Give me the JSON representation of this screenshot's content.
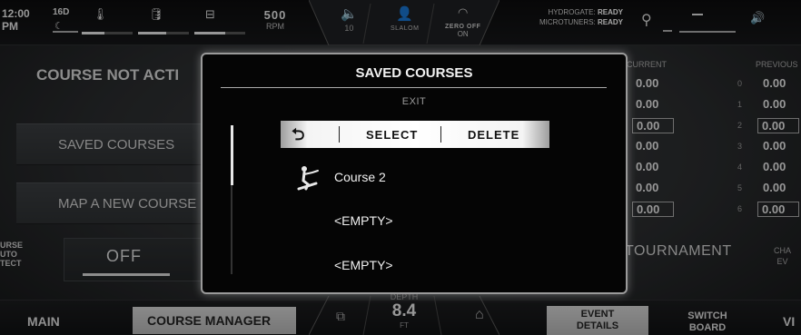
{
  "topbar": {
    "time_line1": "12:00",
    "time_line2": "PM",
    "temp": "16D",
    "rpm_value": "500",
    "rpm_unit": "RPM",
    "volume_level": "10",
    "slalom_label": "SLALOM",
    "zerooff_label": "ZERO OFF",
    "zerooff_state": "ON",
    "hydrogate_label": "HYDROGATE:",
    "hydrogate_status": "READY",
    "microtuners_label": "MICROTUNERS:",
    "microtuners_status": "READY",
    "gauges": [
      {
        "icon": "thermometer-icon",
        "level": 0.45
      },
      {
        "icon": "oil-can-icon",
        "level": 0.55
      },
      {
        "icon": "battery-icon",
        "level": 0.6
      }
    ]
  },
  "left": {
    "title": "COURSE NOT ACTI",
    "saved_courses": "SAVED COURSES",
    "map_new": "MAP A NEW COURSE",
    "auto_detect": "URSE\nUTO\nTECT",
    "auto_detect_state": "OFF"
  },
  "right": {
    "current_header": "CURRENT",
    "previous_header": "PREVIOUS",
    "rows": [
      {
        "index": "0",
        "current": "0.00",
        "previous": "0.00"
      },
      {
        "index": "1",
        "current": "0.00",
        "previous": "0.00"
      },
      {
        "index": "2",
        "current": "0.00",
        "previous": "0.00"
      },
      {
        "index": "3",
        "current": "0.00",
        "previous": "0.00"
      },
      {
        "index": "4",
        "current": "0.00",
        "previous": "0.00"
      },
      {
        "index": "5",
        "current": "0.00",
        "previous": "0.00"
      },
      {
        "index": "6",
        "current": "0.00",
        "previous": "0.00"
      }
    ],
    "tournament": "TOURNAMENT",
    "cha_line1": "CHA",
    "cha_line2": "EV"
  },
  "bottom": {
    "main": "MAIN",
    "course_manager": "COURSE MANAGER",
    "depth_label": "DEPTH",
    "depth_value": "8.4",
    "depth_unit": "FT",
    "event_details_1": "EVENT",
    "event_details_2": "DETAILS",
    "switch_board_1": "SWITCH",
    "switch_board_2": "BOARD",
    "vi": "VI"
  },
  "modal": {
    "title": "SAVED COURSES",
    "exit": "EXIT",
    "select": "SELECT",
    "delete": "DELETE",
    "courses": [
      "Course 2",
      "<EMPTY>",
      "<EMPTY>"
    ]
  }
}
